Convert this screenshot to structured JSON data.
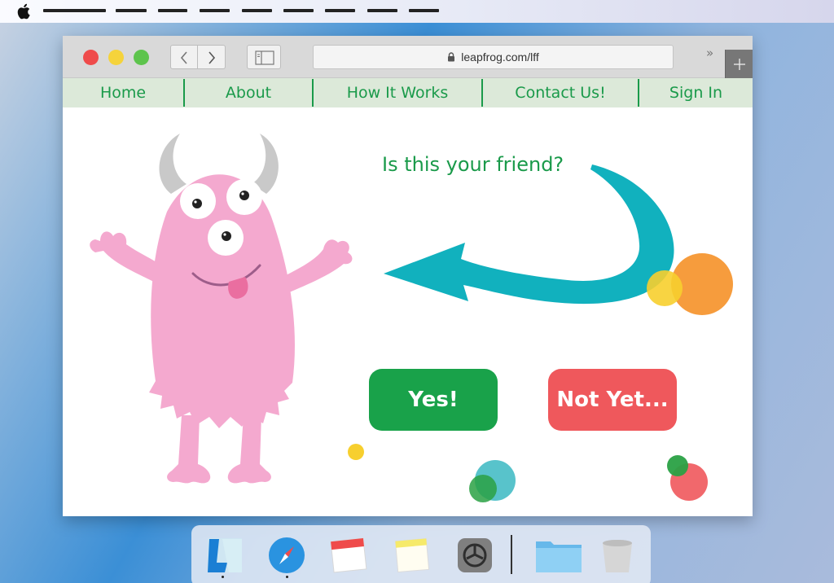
{
  "menubar": {
    "apple_icon": "apple-logo-icon",
    "menu_count": 9
  },
  "browser": {
    "url": "leapfrog.com/lff",
    "traffic_lights": [
      "#ef4b4b",
      "#f5d33b",
      "#5dc44c"
    ],
    "more_label": "»"
  },
  "nav": {
    "items": [
      {
        "label": "Home"
      },
      {
        "label": "About"
      },
      {
        "label": "How It Works"
      },
      {
        "label": "Contact Us!"
      },
      {
        "label": "Sign In"
      }
    ],
    "color": "#1a9a4a",
    "background": "#dce9d9"
  },
  "main": {
    "question": "Is this your friend?",
    "yes_label": "Yes!",
    "no_label": "Not Yet...",
    "illustration": "pink-monster-illustration",
    "arrow_icon": "curved-arrow-icon"
  },
  "colors": {
    "brand_green": "#1a9a4a",
    "accent_red": "#ef585c",
    "arrow_teal": "#11b1be",
    "monster_pink": "#f4a9cf"
  },
  "dock": {
    "apps": [
      {
        "name": "launchpad-icon"
      },
      {
        "name": "safari-icon"
      },
      {
        "name": "calendar-icon"
      },
      {
        "name": "notes-icon"
      },
      {
        "name": "system-preferences-icon"
      },
      {
        "name": "folder-icon"
      },
      {
        "name": "trash-icon"
      }
    ]
  }
}
